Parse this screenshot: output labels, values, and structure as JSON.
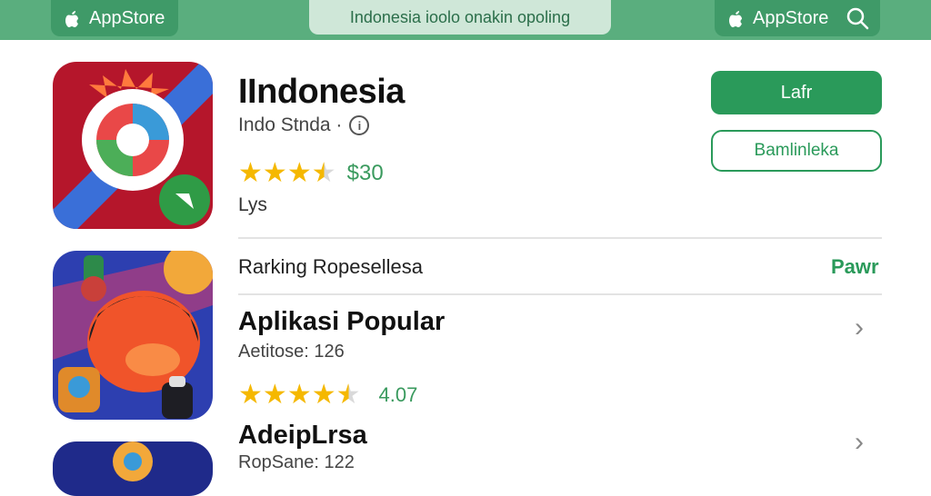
{
  "header": {
    "brand_left": "AppStore",
    "search_text": "Indonesia ioolo onakin opoling",
    "brand_right": "AppStore"
  },
  "featured": {
    "title": "IIndonesia",
    "subtitle": "Indo Stnda ·",
    "rating": 3.5,
    "price": "$30",
    "extra": "Lys",
    "primary_button": "Lafr",
    "secondary_button": "Bamlinleka"
  },
  "ranking": {
    "label": "Rarking Ropesellesa",
    "link": "Pawr"
  },
  "list": [
    {
      "title": "Aplikasi Popular",
      "subtitle": "Aetitose: 126",
      "rating": 4.5,
      "rating_text": "4.07"
    },
    {
      "title": "AdeipLrsa",
      "subtitle": "RopSane: 122"
    }
  ],
  "colors": {
    "accent": "#2a9a5a",
    "topbar": "#5aae7e",
    "star": "#f5b800"
  },
  "icons": [
    "apple-icon",
    "search-icon",
    "info-icon",
    "star-icon",
    "chevron-right-icon"
  ]
}
